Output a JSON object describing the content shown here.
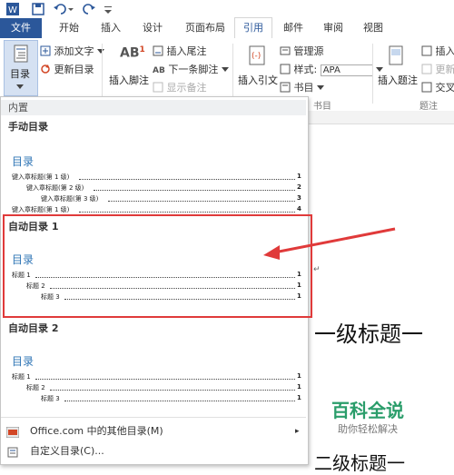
{
  "quick_access": {
    "save_icon": "save-icon",
    "undo_icon": "undo-icon",
    "redo_icon": "redo-icon"
  },
  "tabs": [
    "文件",
    "开始",
    "插入",
    "设计",
    "页面布局",
    "引用",
    "邮件",
    "审阅",
    "视图"
  ],
  "ribbon": {
    "toc_label": "目录",
    "add_text": "添加文字",
    "update_toc": "更新目录",
    "insert_footnote": "插入脚注",
    "footnote_icon_text": "AB",
    "footnote_sup": "1",
    "insert_endnote": "插入尾注",
    "next_footnote": "下一条脚注",
    "show_notes": "显示备注",
    "insert_citation": "插入引文",
    "manage_sources": "管理源",
    "style_label": "样式:",
    "style_value": "APA",
    "bibliography": "书目",
    "group_bibliography": "书目",
    "insert_caption": "插入题注",
    "insert_table": "插入",
    "update_table": "更新",
    "cross_ref": "交叉",
    "group_captions": "题注"
  },
  "gallery": {
    "header": "内置",
    "manual": {
      "name": "手动目录",
      "title": "目录",
      "lines": [
        {
          "text": "键入章标题(第 1 级)",
          "page": "1"
        },
        {
          "text": "键入章标题(第 2 级)",
          "page": "2"
        },
        {
          "text": "键入章标题(第 3 级)",
          "page": "3"
        },
        {
          "text": "键入章标题(第 1 级)",
          "page": "4"
        }
      ]
    },
    "auto1": {
      "name": "自动目录 1",
      "title": "目录",
      "lines": [
        {
          "text": "标题 1",
          "page": "1"
        },
        {
          "text": "标题 2",
          "page": "1"
        },
        {
          "text": "标题 3",
          "page": "1"
        }
      ]
    },
    "auto2": {
      "name": "自动目录 2",
      "title": "目录",
      "lines": [
        {
          "text": "标题 1",
          "page": "1"
        },
        {
          "text": "标题 2",
          "page": "1"
        },
        {
          "text": "标题 3",
          "page": "1"
        }
      ]
    },
    "more": "Office.com 中的其他目录(M)",
    "custom": "自定义目录(C)..."
  },
  "document": {
    "heading1": "一级标题一",
    "heading2": "二级标题一",
    "para_mark": "↵"
  },
  "watermark": {
    "title": "百科全说",
    "subtitle": "助你轻松解决"
  },
  "colors": {
    "accent": "#2b579a",
    "red": "#e03a3a",
    "toc_blue": "#2e74b5"
  }
}
